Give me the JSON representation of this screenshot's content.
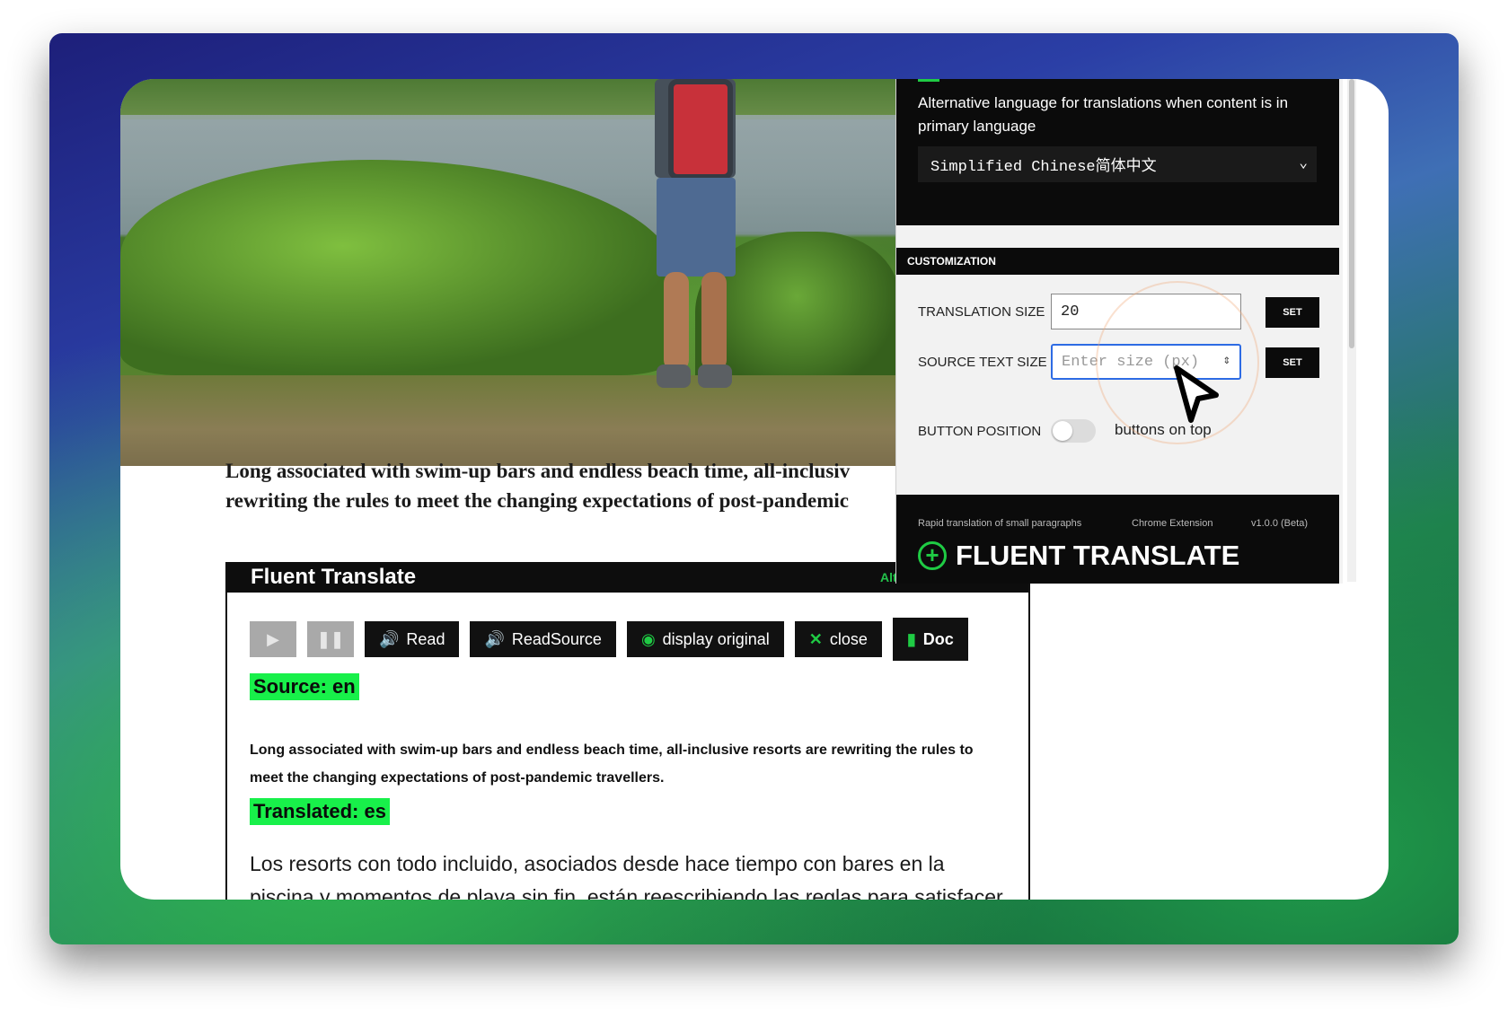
{
  "article": {
    "lead": "Long associated with swim-up bars and endless beach time, all-inclusive resorts are rewriting the rules to meet the changing expectations of post-pandemic travellers.",
    "lead_line1": "Long associated with swim-up bars and endless beach time, all-inclusiv",
    "lead_line2": "rewriting the rules to meet the changing expectations of post-pandemic"
  },
  "fluent_panel": {
    "title": "Fluent Translate",
    "alt_link": "Alt",
    "buttons": {
      "read": "Read",
      "read_source": "ReadSource",
      "display_original": "display original",
      "close": "close",
      "doc": "Doc"
    },
    "source_tag": "Source: en",
    "source_text": "Long associated with swim-up bars and endless beach time, all-inclusive resorts are rewriting the rules to meet the changing expectations of post-pandemic travellers.",
    "translated_tag": "Translated: es",
    "translated_text": "Los resorts con todo incluido, asociados desde hace tiempo con bares en la piscina y momentos de playa sin fin, están reescribiendo las reglas para satisfacer las expectativas cambiantes de los viajeros pospandemia."
  },
  "popup": {
    "alt_language_label": "Alternative language for translations when content is in primary language",
    "alt_language_value": "Simplified Chinese简体中文",
    "customization_header": "CUSTOMIZATION",
    "translation_size_label": "TRANSLATION SIZE",
    "translation_size_value": "20",
    "source_text_size_label": "SOURCE TEXT SIZE",
    "source_text_size_placeholder": "Enter size (px)",
    "set_label": "SET",
    "button_position_label": "BUTTON POSITION",
    "button_position_text": "buttons on top",
    "button_position_on": false,
    "footer": {
      "tagline": "Rapid translation of small paragraphs",
      "platform": "Chrome Extension",
      "version": "v1.0.0 (Beta)",
      "brand": "FLUENT TRANSLATE"
    }
  },
  "colors": {
    "accent_green": "#18f04a",
    "panel_black": "#0b0b0b",
    "focus_blue": "#2d6be4"
  }
}
